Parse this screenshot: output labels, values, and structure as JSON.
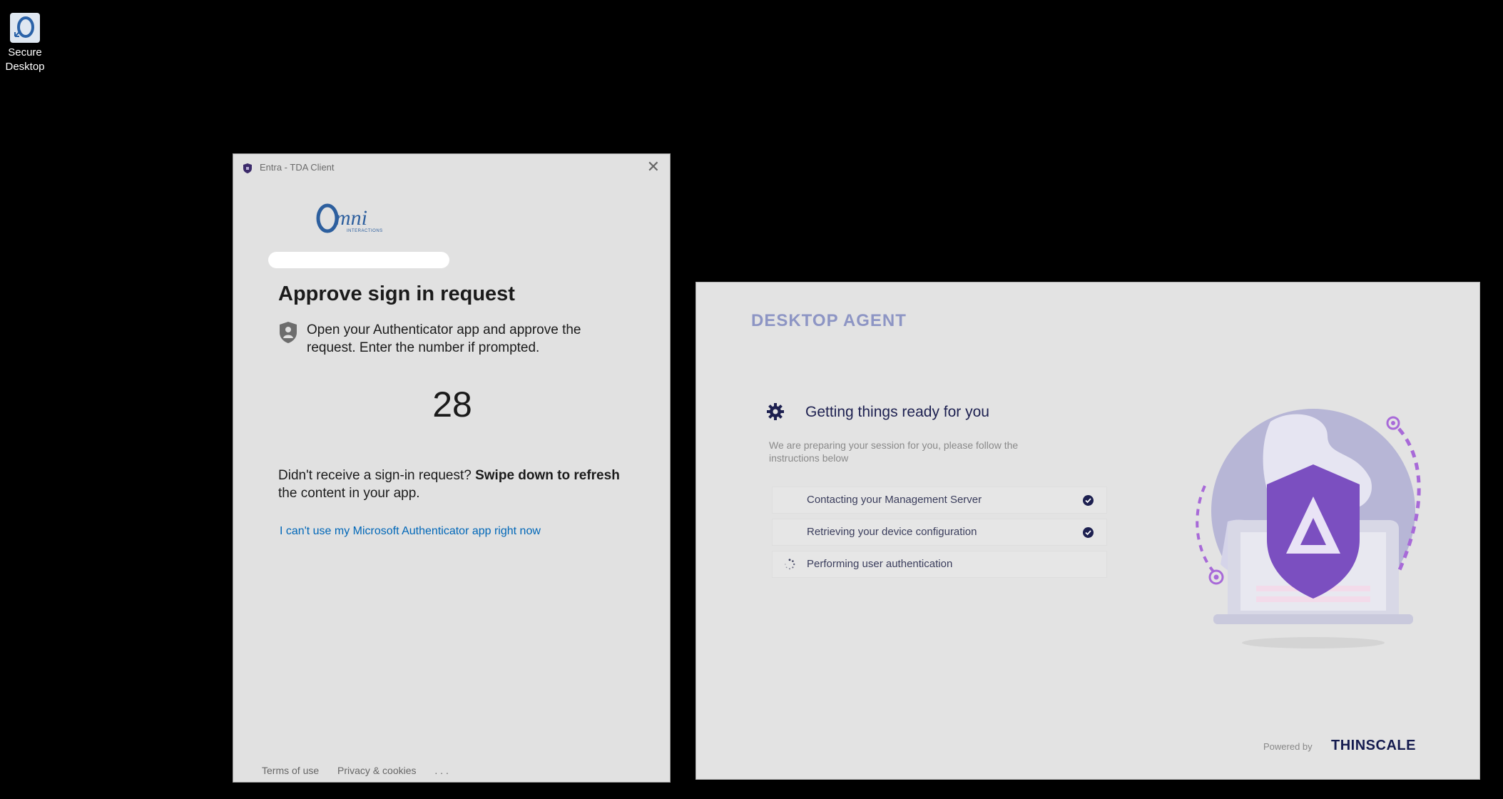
{
  "desktop": {
    "icon_label_line1": "Secure",
    "icon_label_line2": "Desktop"
  },
  "entra": {
    "window_title": "Entra - TDA Client",
    "logo_text": "Omni",
    "logo_subtext": "INTERACTIONS",
    "heading": "Approve sign in request",
    "instruction": "Open your Authenticator app and approve the request. Enter the number if prompted.",
    "number": "28",
    "didnt_receive_prefix": "Didn't receive a sign-in request? ",
    "didnt_receive_bold": "Swipe down to refresh",
    "didnt_receive_suffix": " the content in your app.",
    "cant_use_link": "I can't use my Microsoft Authenticator app right now",
    "footer": {
      "terms": "Terms of use",
      "privacy": "Privacy & cookies",
      "more": ". . ."
    }
  },
  "agent": {
    "brand": "DESKTOP AGENT",
    "heading": "Getting things ready for you",
    "subtext": "We are preparing your session for you, please follow the instructions below",
    "steps": [
      {
        "label": "Contacting your Management Server",
        "status": "done"
      },
      {
        "label": "Retrieving your device configuration",
        "status": "done"
      },
      {
        "label": "Performing user authentication",
        "status": "in-progress"
      }
    ],
    "powered_by": "Powered by",
    "vendor": "THINSCALE"
  },
  "colors": {
    "link": "#0067b8",
    "agent_navy": "#1d2050",
    "brand_lavender": "#8d95c4",
    "illustration_purple": "#7b4fc0"
  }
}
